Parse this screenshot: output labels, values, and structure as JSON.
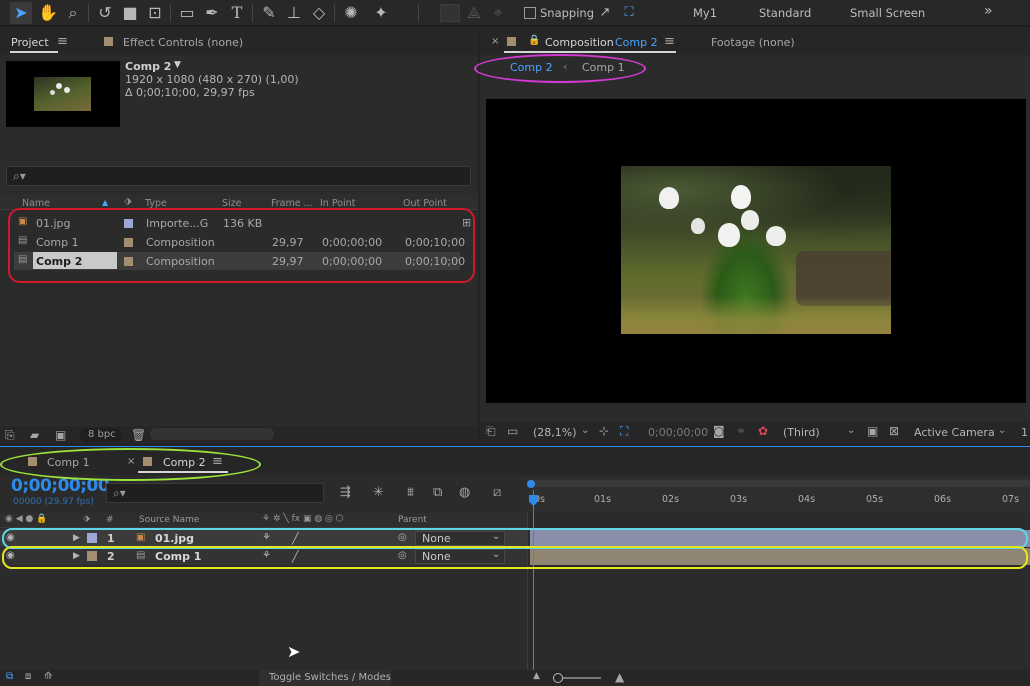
{
  "toolbar": {
    "snapping_label": "Snapping",
    "workspaces": [
      "My1",
      "Standard",
      "Small Screen"
    ],
    "more": "»"
  },
  "project_panel": {
    "tab_label": "Project",
    "effect_controls_label": "Effect Controls (none)",
    "comp_name": "Comp 2",
    "comp_dims": "1920 x 1080  (480 x 270) (1,00)",
    "comp_duration": "Δ 0;00;10;00, 29,97 fps",
    "search_placeholder": "",
    "columns": [
      "Name",
      "Type",
      "Size",
      "Frame ...",
      "In Point",
      "Out Point"
    ],
    "items": [
      {
        "name": "01.jpg",
        "type": "Importe...G",
        "size": "136 KB",
        "fps": "",
        "in": "",
        "out": "",
        "color": "#9ea6d6"
      },
      {
        "name": "Comp 1",
        "type": "Composition",
        "size": "",
        "fps": "29,97",
        "in": "0;00;00;00",
        "out": "0;00;10;00",
        "color": "#a38e72"
      },
      {
        "name": "Comp 2",
        "type": "Composition",
        "size": "",
        "fps": "29,97",
        "in": "0;00;00;00",
        "out": "0;00;10;00",
        "color": "#a38e72"
      }
    ],
    "bpc": "8 bpc"
  },
  "comp_panel": {
    "tab_prefix": "Composition",
    "tab_comp": "Comp 2",
    "footage_label": "Footage (none)",
    "breadcrumb": [
      "Comp 2",
      "Comp 1"
    ],
    "zoom": "(28,1%)",
    "timecode": "0;00;00;00",
    "resolution": "(Third)",
    "camera": "Active Camera",
    "views": "1"
  },
  "timeline": {
    "tabs": [
      "Comp 1",
      "Comp 2"
    ],
    "timecode": "0;00;00;00",
    "fps_sub": "00000 (29.97 fps)",
    "column_headers": {
      "num": "#",
      "source": "Source Name",
      "parent": "Parent"
    },
    "ruler": [
      "0s",
      "01s",
      "02s",
      "03s",
      "04s",
      "05s",
      "06s",
      "07s"
    ],
    "layers": [
      {
        "num": "1",
        "name": "01.jpg",
        "parent": "None",
        "color": "#9ea6d6"
      },
      {
        "num": "2",
        "name": "Comp 1",
        "parent": "None",
        "color": "#a38e72"
      }
    ],
    "toggle_label": "Toggle Switches / Modes"
  },
  "colors": {
    "accent_blue": "#2d8ceb",
    "annotation_red": "#d11a2a",
    "annotation_magenta": "#d23ad2",
    "annotation_green": "#9be23a",
    "annotation_yellow": "#e5e51e",
    "annotation_cyan": "#5fd6e8"
  }
}
